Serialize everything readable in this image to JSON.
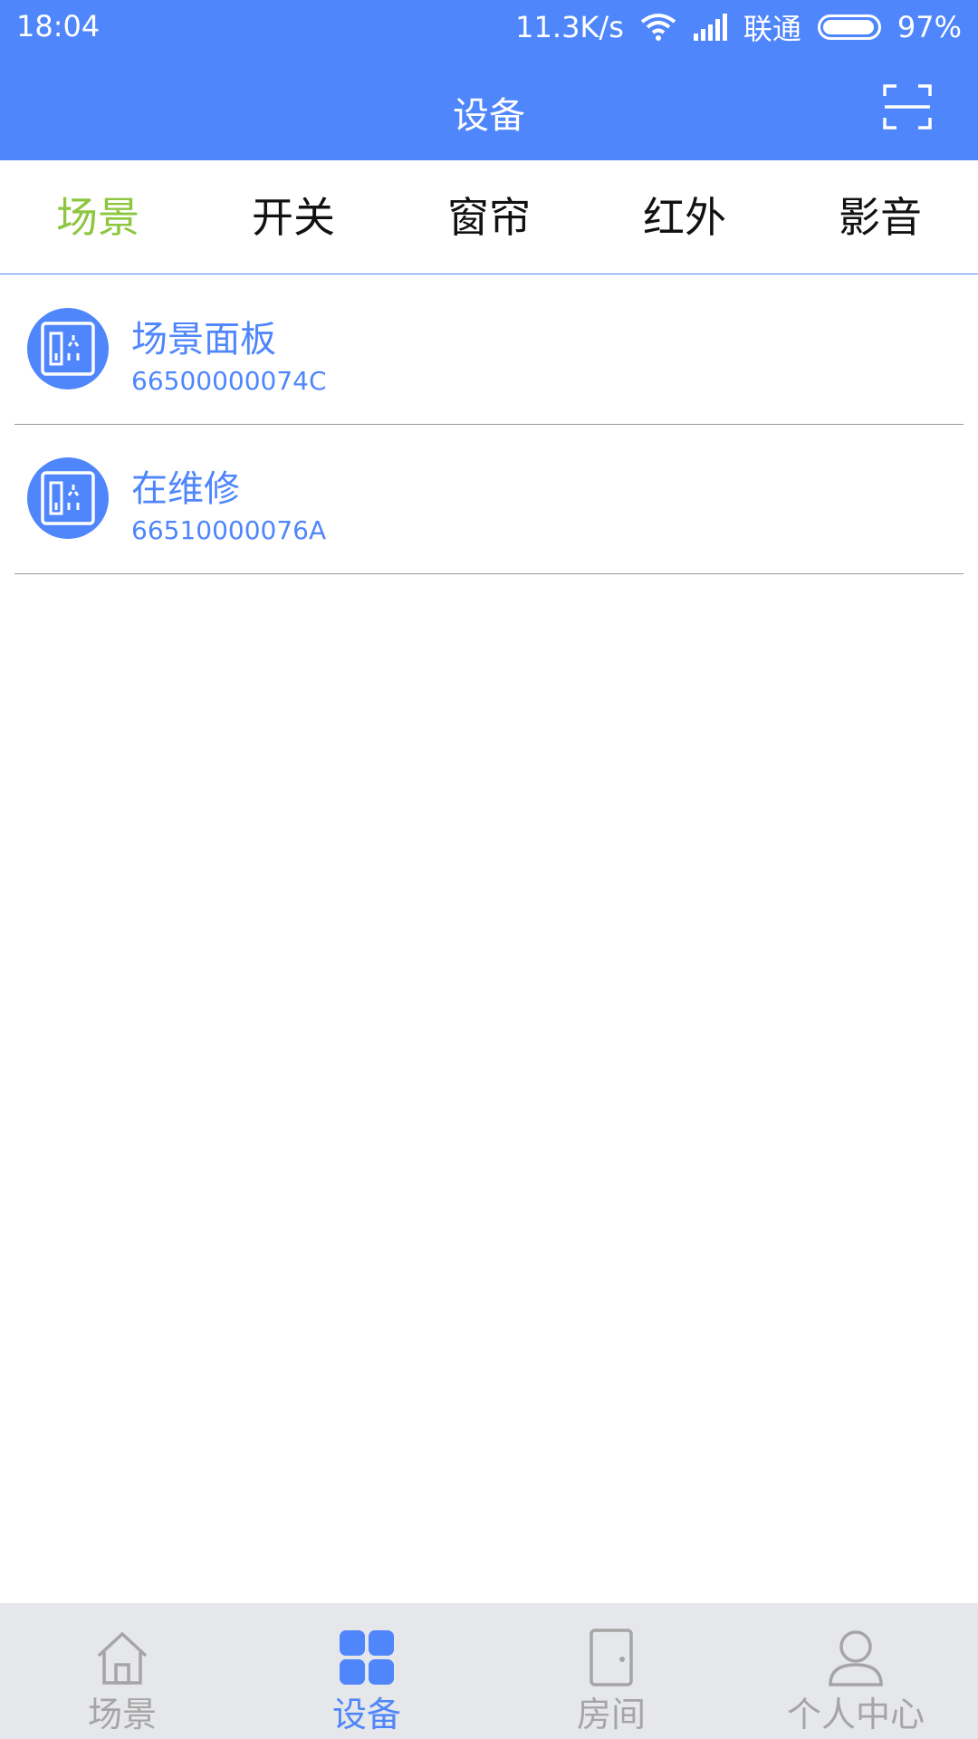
{
  "status_bar": {
    "time": "18:04",
    "network_speed": "11.3K/s",
    "carrier": "联通",
    "battery": "97%",
    "icons": [
      "wifi-icon",
      "signal-icon",
      "battery-icon"
    ]
  },
  "header": {
    "title": "设备",
    "action_icon": "scan-icon"
  },
  "tabs": [
    {
      "label": "场景",
      "active": true
    },
    {
      "label": "开关",
      "active": false
    },
    {
      "label": "窗帘",
      "active": false
    },
    {
      "label": "红外",
      "active": false
    },
    {
      "label": "影音",
      "active": false
    }
  ],
  "devices": [
    {
      "name": "场景面板",
      "code": "66500000074C",
      "icon": "scene-panel-icon"
    },
    {
      "name": "在维修",
      "code": "66510000076A",
      "icon": "scene-panel-icon"
    }
  ],
  "bottom_nav": [
    {
      "label": "场景",
      "icon": "home-icon",
      "active": false
    },
    {
      "label": "设备",
      "icon": "devices-grid-icon",
      "active": true
    },
    {
      "label": "房间",
      "icon": "door-icon",
      "active": false
    },
    {
      "label": "个人中心",
      "icon": "user-icon",
      "active": false
    }
  ],
  "colors": {
    "primary": "#4f86fb",
    "active_tab": "#8dc63f",
    "nav_background": "#e6e7ea",
    "nav_inactive": "#a5a5a5"
  }
}
